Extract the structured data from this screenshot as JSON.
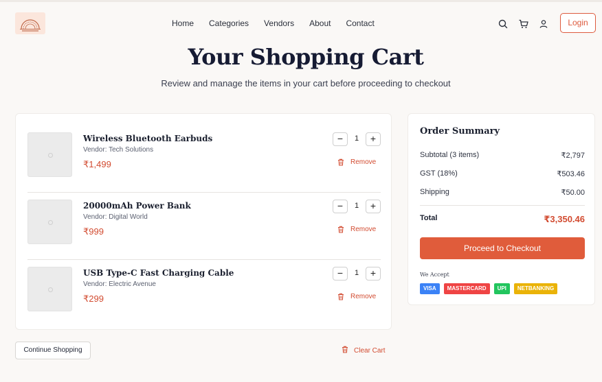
{
  "nav": {
    "items": [
      "Home",
      "Categories",
      "Vendors",
      "About",
      "Contact"
    ],
    "login_label": "Login"
  },
  "icons": {
    "search": "search-icon",
    "cart": "cart-icon",
    "user": "user-icon",
    "trash": "trash-icon"
  },
  "hero": {
    "title": "Your Shopping Cart",
    "subtitle": "Review and manage the items in your cart before proceeding to checkout"
  },
  "cart": {
    "items": [
      {
        "name": "Wireless Bluetooth Earbuds",
        "vendor": "Vendor: Tech Solutions",
        "price": "₹1,499",
        "quantity": "1",
        "remove_label": "Remove"
      },
      {
        "name": "20000mAh Power Bank",
        "vendor": "Vendor: Digital World",
        "price": "₹999",
        "quantity": "1",
        "remove_label": "Remove"
      },
      {
        "name": "USB Type-C Fast Charging Cable",
        "vendor": "Vendor: Electric Avenue",
        "price": "₹299",
        "quantity": "1",
        "remove_label": "Remove"
      }
    ],
    "qty_minus": "−",
    "qty_plus": "+",
    "continue_label": "Continue Shopping",
    "clear_label": "Clear Cart"
  },
  "summary": {
    "title": "Order Summary",
    "subtotal_label": "Subtotal (3 items)",
    "subtotal_value": "₹2,797",
    "gst_label": "GST (18%)",
    "gst_value": "₹503.46",
    "shipping_label": "Shipping",
    "shipping_value": "₹50.00",
    "total_label": "Total",
    "total_value": "₹3,350.46",
    "checkout_label": "Proceed to Checkout",
    "we_accept": "We Accept",
    "payment_methods": [
      {
        "label": "VISA",
        "color": "#3b82f6"
      },
      {
        "label": "MASTERCARD",
        "color": "#ef4444"
      },
      {
        "label": "UPI",
        "color": "#22c55e"
      },
      {
        "label": "NETBANKING",
        "color": "#eab308"
      }
    ]
  },
  "colors": {
    "accent": "#e05c3b",
    "price": "#d24b30",
    "background": "#faf8f6"
  }
}
